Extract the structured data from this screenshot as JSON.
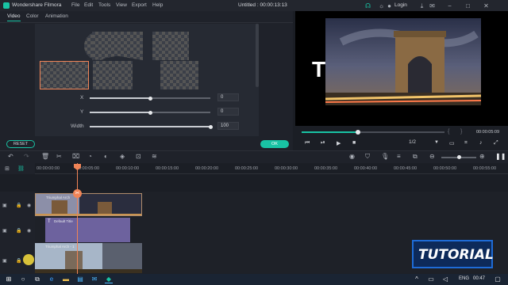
{
  "titlebar": {
    "app_name": "Wondershare Filmora",
    "menu": [
      "File",
      "Edit",
      "Tools",
      "View",
      "Export",
      "Help"
    ],
    "project_title": "Untitled : 00:00:13:13",
    "login_label": "Login"
  },
  "left_panel": {
    "tabs": [
      "Video",
      "Color",
      "Animation"
    ],
    "active_tab": "Video",
    "sliders": [
      {
        "label": "X",
        "value": "0",
        "level": 0.5
      },
      {
        "label": "Y",
        "value": "0",
        "level": 0.5
      },
      {
        "label": "Width",
        "value": "100",
        "level": 1.0
      }
    ],
    "reset_label": "RESET",
    "ok_label": "OK"
  },
  "preview": {
    "overlay_text": "To                ct",
    "time": "00:00:05:09",
    "page": "1/2",
    "progress": 0.39
  },
  "timeline": {
    "ruler_labels": [
      "00:00:00:00",
      "00:00:05:00",
      "00:00:10:00",
      "00:00:15:00",
      "00:00:20:00",
      "00:00:25:00",
      "00:00:30:00",
      "00:00:35:00",
      "00:00:40:00",
      "00:00:45:00",
      "00:00:50:00",
      "00:00:55:00"
    ],
    "clips": {
      "clip1": "Triumphal Arch",
      "clip2": "Default Title",
      "clip3": "Triumphal Arch - 1"
    }
  },
  "watermark": {
    "text": "TUTORIAL"
  },
  "taskbar": {
    "lang": "ENG",
    "clock": "00:47"
  },
  "colors": {
    "accent": "#19c3a4",
    "playhead": "#f08457",
    "title_clip": "#6d629e"
  }
}
